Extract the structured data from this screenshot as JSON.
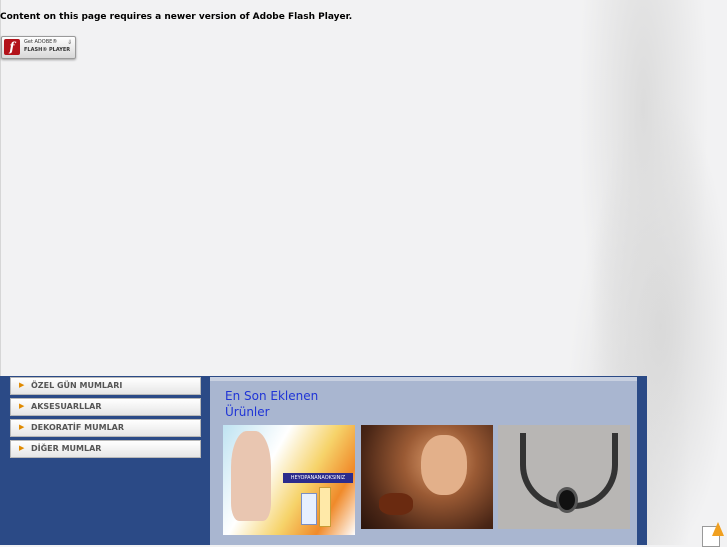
{
  "flash": {
    "message": "Content on this page requires a newer version of Adobe Flash Player.",
    "badge_line1": "Get ADOBE®",
    "badge_line2": "FLASH® PLAYER"
  },
  "menu": {
    "items": [
      {
        "label": "ÖZEL GÜN MUMLARI"
      },
      {
        "label": "AKSESUARLLAR"
      },
      {
        "label": "DEKORATİF MUMLAR"
      },
      {
        "label": "DİĞER MUMLAR"
      }
    ]
  },
  "products": {
    "title": "En Son Eklenen Ürünler",
    "banner_text": "HEYOPANANAOKSINIZ"
  },
  "colors": {
    "panel_bg": "#2b4a86",
    "products_bg": "#a9b6d0",
    "title_color": "#1f34d6",
    "menu_arrow": "#e08a00"
  }
}
